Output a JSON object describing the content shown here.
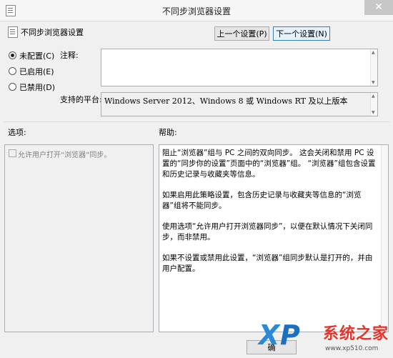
{
  "window": {
    "title": "不同步浏览器设置",
    "close_glyph": "✕"
  },
  "header": {
    "policy_title": "不同步浏览器设置",
    "prev_label": "上一个设置(P)",
    "next_label": "下一个设置(N)"
  },
  "state": {
    "options": [
      {
        "label": "未配置(C)",
        "selected": true
      },
      {
        "label": "已启用(E)",
        "selected": false
      },
      {
        "label": "已禁用(D)",
        "selected": false
      }
    ]
  },
  "comment": {
    "label": "注释:",
    "value": ""
  },
  "platform": {
    "label": "支持的平台:",
    "value": "Windows Server 2012、Windows 8 或 Windows RT 及以上版本"
  },
  "sections": {
    "options_label": "选项:",
    "help_label": "帮助:"
  },
  "options_pane": {
    "checkbox_label": "允许用户打开“浏览器”同步。",
    "checked": false,
    "enabled": false
  },
  "help": {
    "paragraphs": [
      "阻止“浏览器”组与 PC 之间的双向同步。 这会关闭和禁用 PC 设置的“同步你的设置”页面中的“浏览器”组。 “浏览器”组包含设置和历史记录与收藏夹等信息。",
      "如果启用此策略设置，包含历史记录与收藏夹等信息的“浏览器”组将不能同步。",
      "使用选项“允许用户打开浏览器同步”，以便在默认情况下关闭同步，而非禁用。",
      "如果不设置或禁用此设置，“浏览器”组同步默认是打开的，并由用户配置。"
    ]
  },
  "footer": {
    "ok_label": "确"
  },
  "watermark": {
    "x": "X",
    "p": "P",
    "brand": "系统之家",
    "url": "www.xp510.com"
  },
  "colors": {
    "window_bg": "#f0f0f0",
    "accent_button_border": "#3c7fb1",
    "watermark_blue": "#1d6fc0",
    "watermark_red": "#e5352b"
  }
}
